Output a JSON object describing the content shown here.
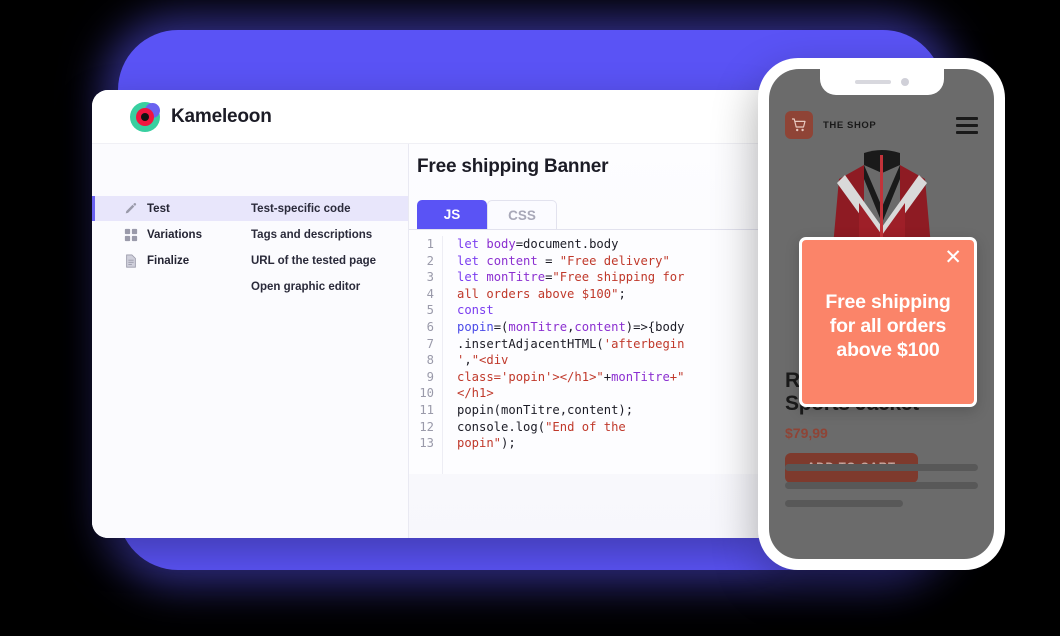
{
  "app": {
    "brand_name": "Kameleoon",
    "brand_logo_icon": "kameleoon-target-logo"
  },
  "sidebar": {
    "items": [
      {
        "label": "Test",
        "icon": "pencil-icon",
        "active": true
      },
      {
        "label": "Variations",
        "icon": "grid-squares-icon",
        "active": false
      },
      {
        "label": "Finalize",
        "icon": "document-icon",
        "active": false
      }
    ]
  },
  "submenu": {
    "items": [
      {
        "label": "Test-specific code",
        "active": true
      },
      {
        "label": "Tags and descriptions",
        "active": false
      },
      {
        "label": "URL of the tested page",
        "active": false
      },
      {
        "label": "Open graphic editor",
        "active": false
      }
    ]
  },
  "editor": {
    "title": "Free shipping Banner",
    "tabs": [
      {
        "label": "JS",
        "active": true
      },
      {
        "label": "CSS",
        "active": false
      }
    ],
    "line_numbers": [
      "1",
      "2",
      "3",
      "4",
      "5",
      "6",
      "7",
      "8",
      "9",
      "10",
      "11",
      "12",
      "13"
    ],
    "code_lines": [
      [
        {
          "t": "let ",
          "c": "kw"
        },
        {
          "t": "body",
          "c": "var"
        },
        {
          "t": "=document.body",
          "c": "plain"
        }
      ],
      [
        {
          "t": "let ",
          "c": "kw"
        },
        {
          "t": "content",
          "c": "var"
        },
        {
          "t": " = ",
          "c": "plain"
        },
        {
          "t": "\"Free delivery\"",
          "c": "str"
        }
      ],
      [
        {
          "t": "let ",
          "c": "kw"
        },
        {
          "t": "monTitre",
          "c": "var"
        },
        {
          "t": "=",
          "c": "plain"
        },
        {
          "t": "\"Free shipping for",
          "c": "str"
        }
      ],
      [
        {
          "t": "all orders above $100\"",
          "c": "str"
        },
        {
          "t": ";",
          "c": "plain"
        }
      ],
      [
        {
          "t": "const",
          "c": "kw"
        }
      ],
      [
        {
          "t": "popin",
          "c": "fn"
        },
        {
          "t": "=(",
          "c": "plain"
        },
        {
          "t": "monTitre",
          "c": "var"
        },
        {
          "t": ",",
          "c": "plain"
        },
        {
          "t": "content",
          "c": "var"
        },
        {
          "t": ")=>{body",
          "c": "plain"
        }
      ],
      [
        {
          "t": ".insertAdjacentHTML(",
          "c": "plain"
        },
        {
          "t": "'afterbegin",
          "c": "str"
        }
      ],
      [
        {
          "t": "'",
          "c": "str"
        },
        {
          "t": ",",
          "c": "plain"
        },
        {
          "t": "\"<div",
          "c": "str"
        }
      ],
      [
        {
          "t": "class='popin'></h1>\"",
          "c": "str"
        },
        {
          "t": "+",
          "c": "plain"
        },
        {
          "t": "monTitre",
          "c": "var"
        },
        {
          "t": "+\"",
          "c": "str"
        }
      ],
      [
        {
          "t": "</h1>",
          "c": "str"
        }
      ],
      [
        {
          "t": "popin(monTitre,content);",
          "c": "plain"
        }
      ],
      [
        {
          "t": "console.log(",
          "c": "plain"
        },
        {
          "t": "\"End of the",
          "c": "str"
        }
      ],
      [
        {
          "t": "popin\"",
          "c": "str"
        },
        {
          "t": ");",
          "c": "plain"
        }
      ]
    ]
  },
  "phone": {
    "shop_name": "THE SHOP",
    "cart_icon": "shopping-cart-icon",
    "menu_icon": "hamburger-menu-icon",
    "product_image_icon": "red-sports-jacket",
    "popup": {
      "close_icon": "close-x-icon",
      "text": "Free shipping for all orders above $100"
    },
    "product": {
      "title": "Red\nSports Jacket",
      "price": "$79,99",
      "add_to_cart_label": "ADD TO CART"
    }
  },
  "colors": {
    "brand_purple": "#5a53f5",
    "popup_coral": "#fb8469",
    "cart_brown": "#7e3a2d",
    "logo_green": "#38cfa0",
    "logo_red": "#f0153f"
  }
}
